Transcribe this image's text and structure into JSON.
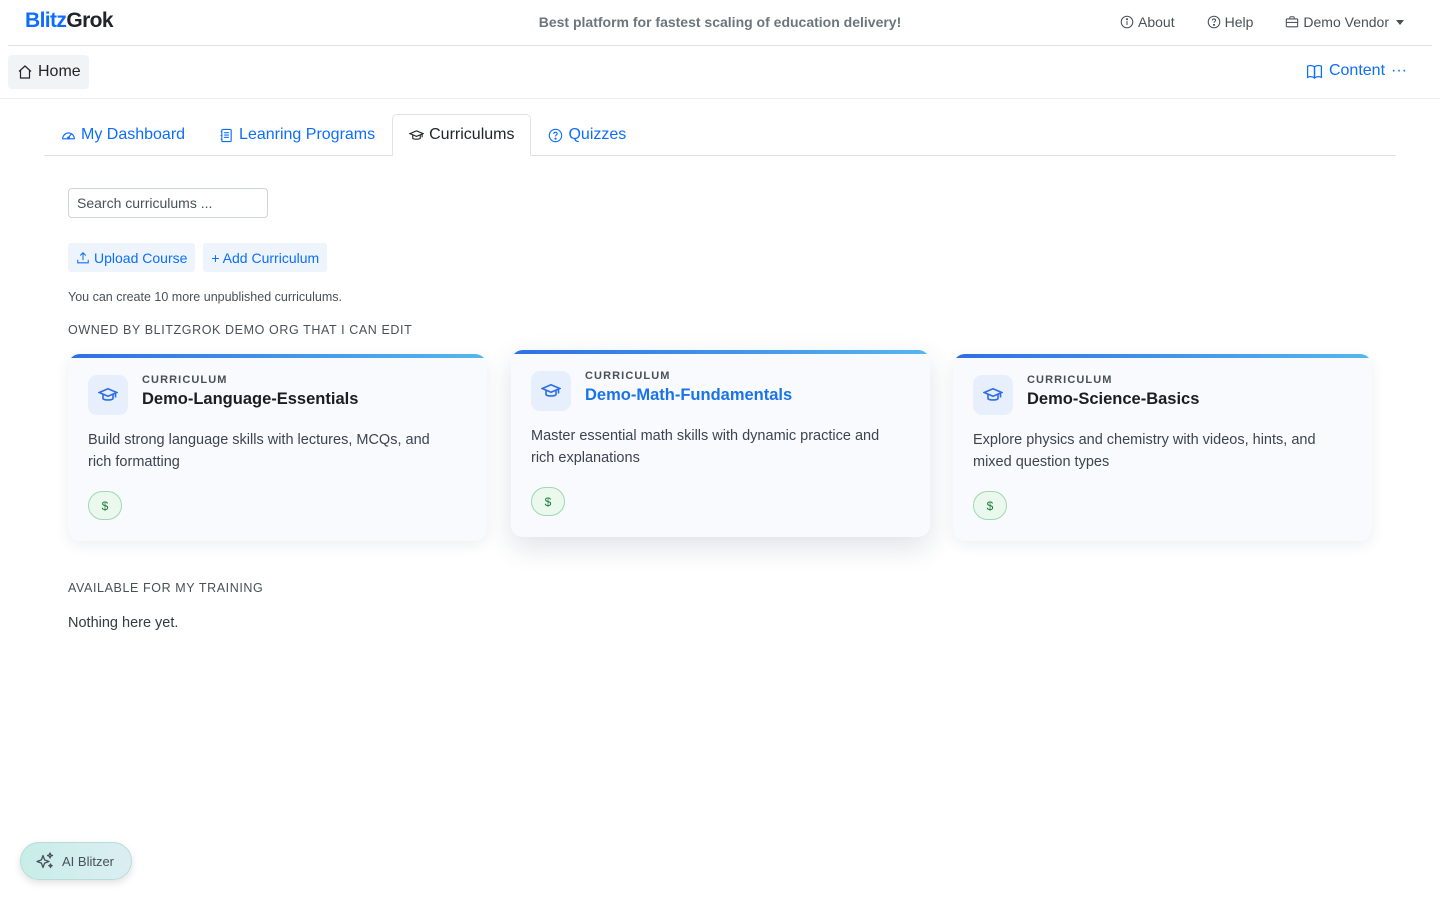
{
  "brand": {
    "part1": "Blitz",
    "part2": "Grok"
  },
  "header": {
    "tagline": "Best platform for fastest scaling of education delivery!",
    "about_label": "About",
    "help_label": "Help",
    "vendor_label": "Demo Vendor"
  },
  "subbar": {
    "home_label": "Home",
    "content_label": "Content",
    "more_glyph": "···"
  },
  "tabs": [
    {
      "label": "My Dashboard",
      "icon": "speedometer-icon"
    },
    {
      "label": "Leanring Programs",
      "icon": "journal-icon"
    },
    {
      "label": "Curriculums",
      "icon": "mortarboard-icon",
      "active": true
    },
    {
      "label": "Quizzes",
      "icon": "question-circle-icon"
    }
  ],
  "search": {
    "placeholder": "Search curriculums ...",
    "value": ""
  },
  "actions": {
    "upload_label": "Upload Course",
    "add_label": "+ Add Curriculum"
  },
  "note": "You can create 10 more unpublished curriculums.",
  "sections": {
    "owned": "OWNED BY BLITZGROK DEMO ORG THAT I CAN EDIT",
    "available": "AVAILABLE FOR MY TRAINING",
    "empty": "Nothing here yet."
  },
  "cards": [
    {
      "kicker": "CURRICULUM",
      "title": "Demo-Language-Essentials",
      "desc": "Build strong language skills with lectures, MCQs, and rich formatting",
      "price": "$"
    },
    {
      "kicker": "CURRICULUM",
      "title": "Demo-Math-Fundamentals",
      "desc": "Master essential math skills with dynamic practice and rich explanations",
      "price": "$"
    },
    {
      "kicker": "CURRICULUM",
      "title": "Demo-Science-Basics",
      "desc": "Explore physics and chemistry with videos, hints, and mixed question types",
      "price": "$"
    }
  ],
  "ai_button": {
    "label": "AI Blitzer"
  },
  "colors": {
    "accent": "#0d6efd",
    "price_green": "#1c7c3a",
    "card_gradient_start": "#2f6fe4",
    "card_gradient_end": "#56b6ee"
  }
}
